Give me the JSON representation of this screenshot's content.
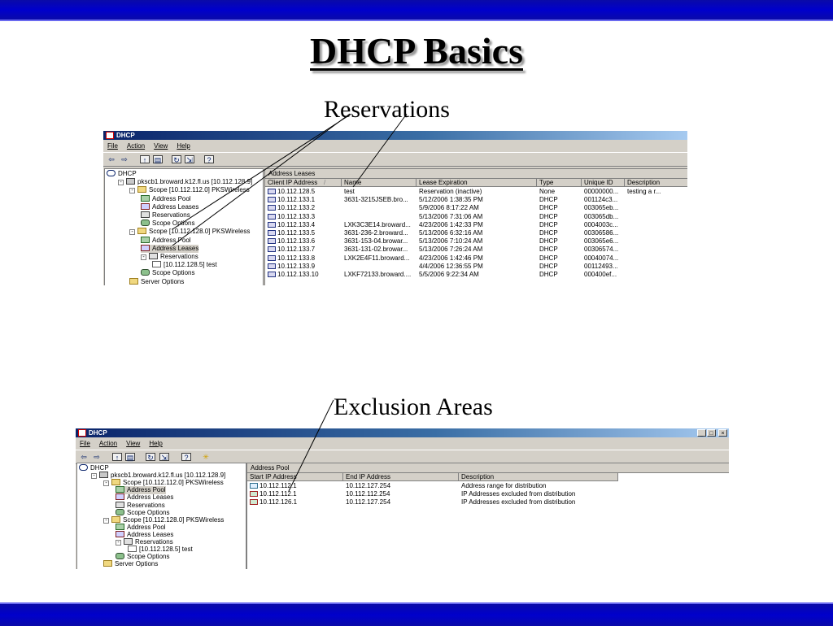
{
  "slide": {
    "title": "DHCP Basics",
    "subtitle1": "Reservations",
    "subtitle2": "Exclusion Areas"
  },
  "colors": {
    "band": "#0000cc",
    "window_chrome": "#d4d0c8",
    "titlebar": "#0a246a"
  },
  "win1": {
    "title": "DHCP",
    "menu": [
      "File",
      "Action",
      "View",
      "Help"
    ],
    "toolbar_icons": [
      "back-arrow-icon",
      "forward-arrow-icon",
      "up-folder-icon",
      "show-tree-icon",
      "refresh-icon",
      "export-icon",
      "help-icon"
    ],
    "tree": [
      "DHCP",
      "pkscb1.broward.k12.fl.us [10.112.128.9]",
      "Scope [10.112.112.0] PKSWireless",
      "Address Pool",
      "Address Leases",
      "Reservations",
      "Scope Options",
      "Scope [10.112.128.0] PKSWireless",
      "Address Pool",
      "Address Leases",
      "Reservations",
      "[10.112.128.5] test",
      "Scope Options",
      "Server Options"
    ],
    "pane_title": "Address Leases",
    "columns": [
      "Client IP Address",
      "Name",
      "Lease Expiration",
      "Type",
      "Unique ID",
      "Description"
    ],
    "sort_indicator": "/",
    "rows": [
      [
        "10.112.128.5",
        "test",
        "Reservation (inactive)",
        "None",
        "00000000...",
        "testing a r..."
      ],
      [
        "10.112.133.1",
        "3631-3215JSEB.bro...",
        "5/12/2006 1:38:35 PM",
        "DHCP",
        "001124c3...",
        ""
      ],
      [
        "10.112.133.2",
        "",
        "5/9/2006 8:17:22 AM",
        "DHCP",
        "003065eb...",
        ""
      ],
      [
        "10.112.133.3",
        "",
        "5/13/2006 7:31:06 AM",
        "DHCP",
        "003065db...",
        ""
      ],
      [
        "10.112.133.4",
        "LXK3C3E14.broward...",
        "4/23/2006 1:42:33 PM",
        "DHCP",
        "0004003c...",
        ""
      ],
      [
        "10.112.133.5",
        "3631-236-2.broward...",
        "5/13/2006 6:32:16 AM",
        "DHCP",
        "00306586...",
        ""
      ],
      [
        "10.112.133.6",
        "3631-153-04.browar...",
        "5/13/2006 7:10:24 AM",
        "DHCP",
        "003065e6...",
        ""
      ],
      [
        "10.112.133.7",
        "3631-131-02.browar...",
        "5/13/2006 7:26:24 AM",
        "DHCP",
        "00306574...",
        ""
      ],
      [
        "10.112.133.8",
        "LXK2E4F11.broward...",
        "4/23/2006 1:42:46 PM",
        "DHCP",
        "00040074...",
        ""
      ],
      [
        "10.112.133.9",
        "",
        "4/4/2006 12:36:55 PM",
        "DHCP",
        "00112493...",
        ""
      ],
      [
        "10.112.133.10",
        "LXKF72133.broward....",
        "5/5/2006 9:22:34 AM",
        "DHCP",
        "000400ef...",
        ""
      ]
    ]
  },
  "win2": {
    "title": "DHCP",
    "window_controls": [
      "_",
      "□",
      "×"
    ],
    "menu": [
      "File",
      "Action",
      "View",
      "Help"
    ],
    "toolbar_icons": [
      "back-arrow-icon",
      "forward-arrow-icon",
      "up-folder-icon",
      "show-tree-icon",
      "refresh-icon",
      "export-icon",
      "help-icon",
      "new-star-icon"
    ],
    "tree": [
      "DHCP",
      "pkscb1.broward.k12.fl.us [10.112.128.9]",
      "Scope [10.112.112.0] PKSWireless",
      "Address Pool",
      "Address Leases",
      "Reservations",
      "Scope Options",
      "Scope [10.112.128.0] PKSWireless",
      "Address Pool",
      "Address Leases",
      "Reservations",
      "[10.112.128.5] test",
      "Scope Options",
      "Server Options"
    ],
    "pane_title": "Address Pool",
    "columns": [
      "Start IP Address",
      "End IP Address",
      "Description"
    ],
    "rows": [
      [
        "10.112.112.1",
        "10.112.127.254",
        "Address range for distribution"
      ],
      [
        "10.112.112.1",
        "10.112.112.254",
        "IP Addresses excluded from distribution"
      ],
      [
        "10.112.126.1",
        "10.112.127.254",
        "IP Addresses excluded from distribution"
      ]
    ]
  }
}
